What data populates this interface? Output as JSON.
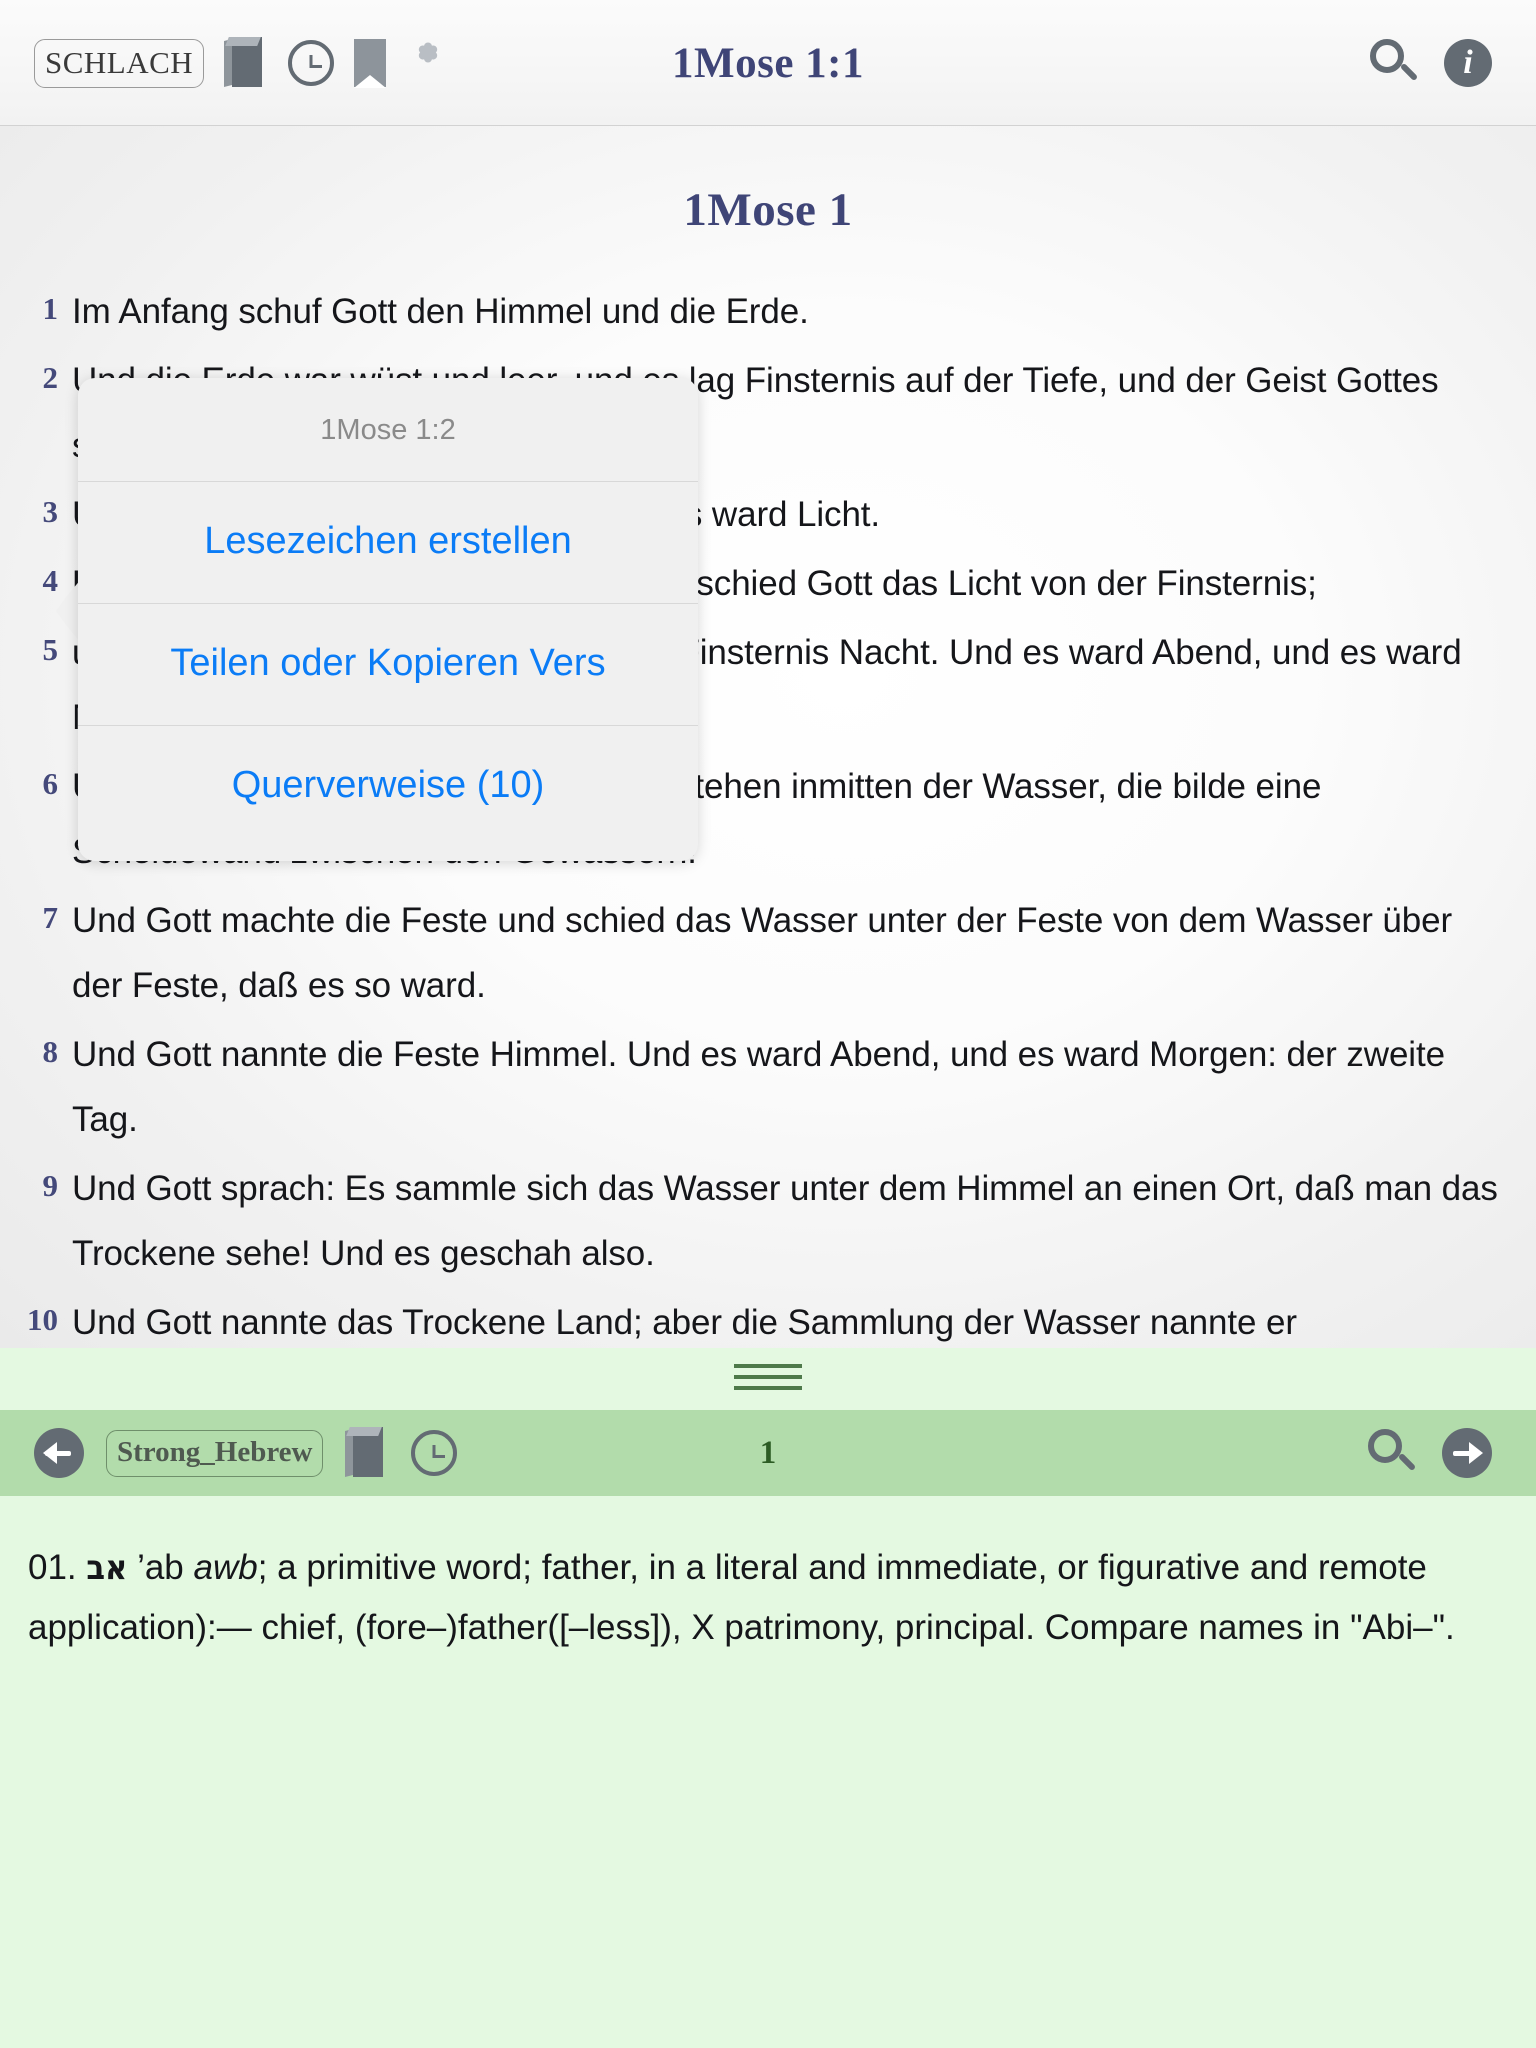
{
  "top_toolbar": {
    "version_button": "SCHLACH",
    "title": "1Mose 1:1",
    "icons": {
      "book": "book-icon",
      "clock": "history-clock-icon",
      "bookmark": "bookmark-icon",
      "asterisk": "asterisk-icon",
      "search": "search-icon",
      "info": "info-icon"
    }
  },
  "bible": {
    "chapter_title": "1Mose 1",
    "verses": [
      {
        "num": "1",
        "text": "Im Anfang schuf Gott den Himmel und die Erde."
      },
      {
        "num": "2",
        "text": "Und die Erde war wüst und leer, und es lag Finsternis auf der Tiefe, und  der Geist Gottes schwebte über den Wassern."
      },
      {
        "num": "3",
        "text": "Und Gott sprach: Es werde Licht! Und es ward Licht."
      },
      {
        "num": "4",
        "text": "Und Gott sah, daß das Licht gut war; da schied Gott das Licht von der  Finsternis;"
      },
      {
        "num": "5",
        "text": "und Gott nannte das Licht Tag, und die Finsternis Nacht. Und es ward  Abend, und es ward Morgen: der erste Tag."
      },
      {
        "num": "6",
        "text": "Und Gott sprach: Es soll eine Feste entstehen inmitten der Wasser, die  bilde eine Scheidewand zwischen den Gewässern!"
      },
      {
        "num": "7",
        "text": "Und Gott machte die Feste und schied das Wasser unter der Feste von dem  Wasser über der Feste, daß es so ward."
      },
      {
        "num": "8",
        "text": "Und Gott nannte die Feste Himmel. Und es ward Abend, und es ward Morgen:  der zweite Tag."
      },
      {
        "num": "9",
        "text": "Und Gott sprach: Es sammle sich das Wasser unter dem Himmel an einen Ort,  daß man das Trockene sehe! Und es geschah also."
      },
      {
        "num": "10",
        "text": "Und Gott nannte das Trockene Land; aber die Sammlung der Wasser nannte er"
      }
    ]
  },
  "popup": {
    "title": "1Mose 1:2",
    "items": [
      "Lesezeichen erstellen",
      "Teilen oder Kopieren Vers",
      "Querverweise (10)"
    ]
  },
  "dictionary": {
    "toolbar": {
      "back": "back-arrow-icon",
      "module_button": "Strong_Hebrew",
      "book": "book-icon",
      "clock": "history-clock-icon",
      "title": "1",
      "search": "search-icon",
      "forward": "forward-arrow-icon"
    },
    "entry": {
      "number": "01.",
      "hebrew": "אב",
      "transliteration": "’ab",
      "pronunciation": "awb",
      "definition": "; a primitive word; father, in a literal and immediate, or figurative and remote application):— chief, (fore–)father([–less]), X patrimony, principal. Compare names in \"Abi–\"."
    }
  },
  "colors": {
    "title_navy": "#3f4577",
    "verse_number": "#44497a",
    "popup_blue": "#0b7cf6",
    "green_toolbar": "#b2dcab",
    "green_pane": "#e4f9e1",
    "green_text": "#2c5c24"
  }
}
